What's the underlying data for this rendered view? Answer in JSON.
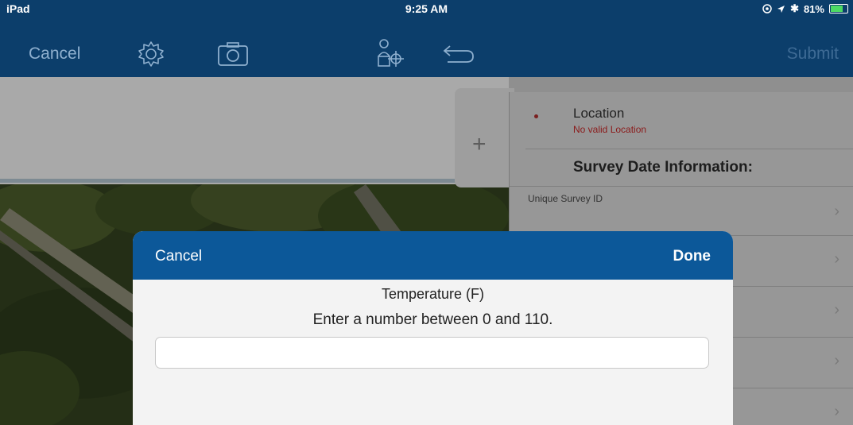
{
  "status_bar": {
    "device": "iPad",
    "time": "9:25 AM",
    "battery": "81%",
    "battery_level": 0.81
  },
  "toolbar": {
    "cancel_label": "Cancel",
    "submit_label": "Submit"
  },
  "survey_panel": {
    "location": {
      "title": "Location",
      "error": "No valid Location"
    },
    "section_title": "Survey Date Information:",
    "first_row_label": "Unique Survey ID"
  },
  "modal": {
    "cancel_label": "Cancel",
    "done_label": "Done",
    "title": "Temperature (F)",
    "hint": "Enter a number between 0 and 110.",
    "value": ""
  },
  "colors": {
    "nav_bar": "#0c3e6b",
    "modal_header": "#0c5899",
    "error_text": "#8b1a1a"
  }
}
